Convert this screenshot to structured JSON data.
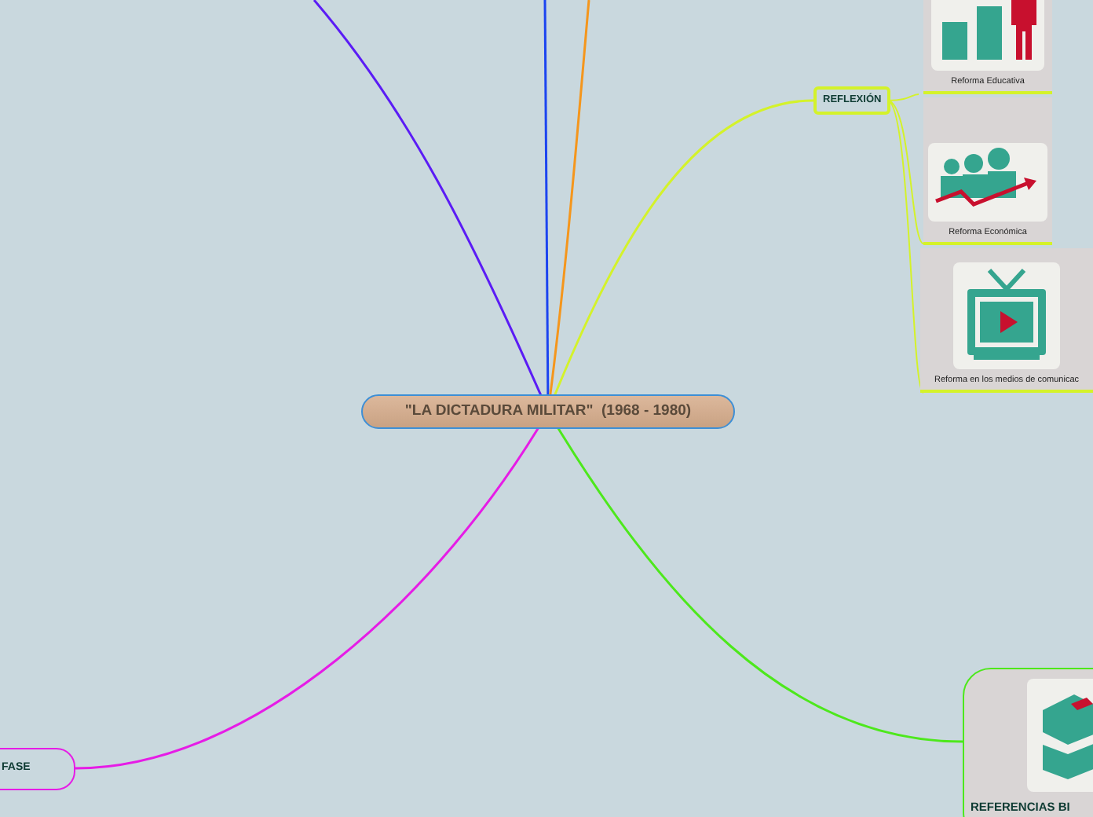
{
  "root": {
    "title": "\"LA DICTADURA MILITAR\"  (1968 - 1980)"
  },
  "connectors": [
    {
      "color": "#5b1cf5"
    },
    {
      "color": "#1c44f0"
    },
    {
      "color": "#f5961c"
    },
    {
      "color": "#d4f22a"
    },
    {
      "color": "#e61ce6"
    },
    {
      "color": "#4de81c"
    }
  ],
  "reflexion": {
    "label": "REFLEXIÓN"
  },
  "cards": [
    {
      "label": "Reforma Educativa",
      "kind": "chart"
    },
    {
      "label": "Reforma Económica",
      "kind": "growth"
    },
    {
      "label": "Reforma en los medios de comunicac",
      "kind": "tv"
    }
  ],
  "references": {
    "label": "REFERENCIAS BI"
  },
  "fase": {
    "label": "FASE"
  }
}
